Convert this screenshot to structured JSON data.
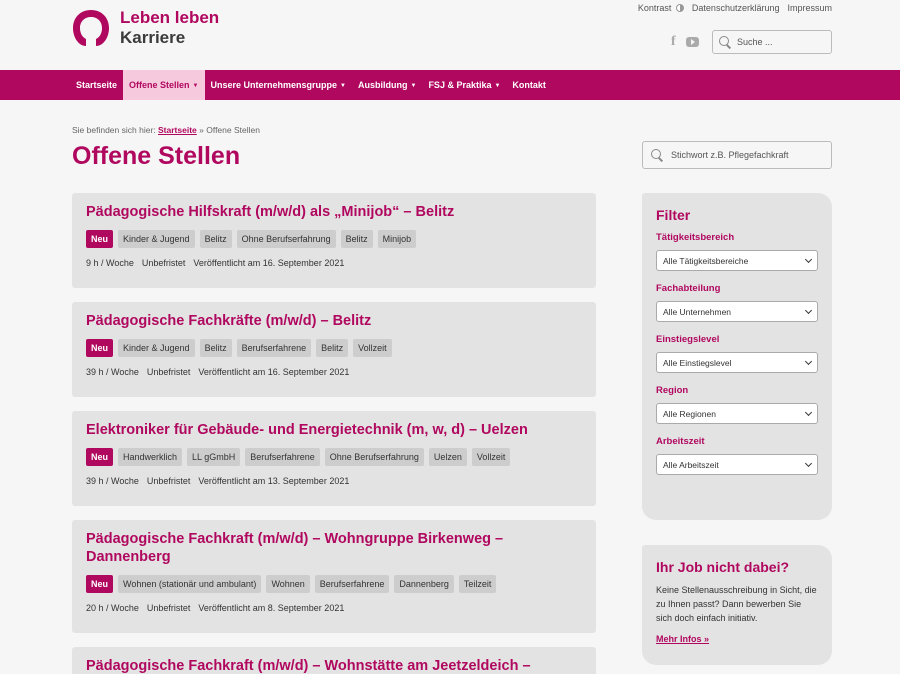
{
  "header": {
    "logo_line1": "Leben leben",
    "logo_line2": "Karriere",
    "toplinks": {
      "contrast": "Kontrast",
      "privacy": "Datenschutzerklärung",
      "imprint": "Impressum"
    },
    "search_placeholder": "Suche ...",
    "colors": {
      "brand": "#b0085f",
      "nav_active_bg": "#f6c9dc"
    }
  },
  "nav": {
    "items": [
      {
        "label": "Startseite",
        "dropdown": false
      },
      {
        "label": "Offene Stellen",
        "dropdown": true
      },
      {
        "label": "Unsere Unternehmensgruppe",
        "dropdown": true
      },
      {
        "label": "Ausbildung",
        "dropdown": true
      },
      {
        "label": "FSJ & Praktika",
        "dropdown": true
      },
      {
        "label": "Kontakt",
        "dropdown": false
      }
    ],
    "caret": "▼"
  },
  "breadcrumb": {
    "prefix": "Sie befinden sich hier:",
    "home": "Startseite",
    "separator": "»",
    "current": "Offene Stellen"
  },
  "page_title": "Offene Stellen",
  "keyword_search_placeholder": "Stichwort z.B. Pflegefachkraft",
  "jobs": [
    {
      "title": " Pädagogische Hilfskraft (m/w/d) als „Minijob“ – Belitz",
      "tags": [
        "Neu",
        "Kinder & Jugend",
        "Belitz",
        "Ohne Berufserfahrung",
        "Belitz",
        "Minijob"
      ],
      "hours": "9 h / Woche",
      "term": "Unbefristet",
      "published": "Veröffentlicht am 16. September 2021"
    },
    {
      "title": " Pädagogische Fachkräfte (m/w/d) – Belitz",
      "tags": [
        "Neu",
        "Kinder & Jugend",
        "Belitz",
        "Berufserfahrene",
        "Belitz",
        "Vollzeit"
      ],
      "hours": "39 h / Woche",
      "term": "Unbefristet",
      "published": "Veröffentlicht am 16. September 2021"
    },
    {
      "title": "Elektroniker für Gebäude- und Energietechnik (m, w, d) – Uelzen",
      "tags": [
        "Neu",
        "Handwerklich",
        "LL gGmbH",
        "Berufserfahrene",
        "Ohne Berufserfahrung",
        "Uelzen",
        "Vollzeit"
      ],
      "hours": "39 h / Woche",
      "term": "Unbefristet",
      "published": "Veröffentlicht am 13. September 2021"
    },
    {
      "title": " Pädagogische Fachkraft (m/w/d) – Wohngruppe Birkenweg – Dannenberg",
      "tags": [
        "Neu",
        "Wohnen (stationär und ambulant)",
        "Wohnen",
        "Berufserfahrene",
        "Dannenberg",
        "Teilzeit"
      ],
      "hours": "20 h / Woche",
      "term": "Unbefristet",
      "published": "Veröffentlicht am 8. September 2021"
    },
    {
      "title": "Pädagogische Fachkraft (m/w/d) – Wohnstätte am Jeetzeldeich –"
    }
  ],
  "filter": {
    "title": "Filter",
    "fields": [
      {
        "label": "Tätigkeitsbereich",
        "value": "Alle Tätigkeitsbereiche"
      },
      {
        "label": "Fachabteilung",
        "value": "Alle Unternehmen"
      },
      {
        "label": "Einstiegslevel",
        "value": "Alle Einstiegslevel"
      },
      {
        "label": "Region",
        "value": "Alle Regionen"
      },
      {
        "label": "Arbeitszeit",
        "value": "Alle Arbeitszeit"
      }
    ]
  },
  "sidebar_job": {
    "title": "Ihr Job nicht dabei?",
    "text": "Keine Stellenausschreibung in Sicht, die zu Ihnen passt? Dann bewerben Sie sich doch einfach initiativ.",
    "link": "Mehr Infos »"
  }
}
